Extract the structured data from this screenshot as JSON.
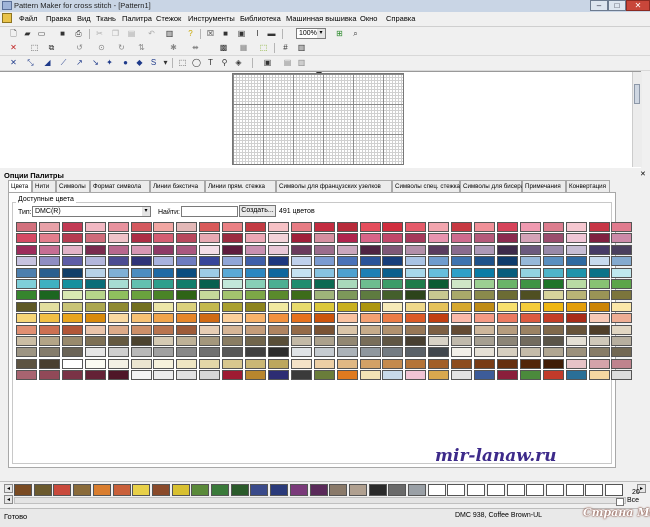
{
  "window": {
    "title": "Pattern Maker for cross stitch - [Pattern1]",
    "minimize_glyph": "–",
    "maximize_glyph": "□",
    "close_glyph": "✕"
  },
  "menu": [
    "Файл",
    "Правка",
    "Вид",
    "Ткань",
    "Палитра",
    "Стежок",
    "Инструменты",
    "Библиотека",
    "Машинная вышивка",
    "Окно",
    "Справка"
  ],
  "toolbar": {
    "zoom_value": "100%",
    "dropdown_glyph": "▾"
  },
  "palette_panel": {
    "title": "Опции Палитры",
    "close_glyph": "✕",
    "tabs": [
      "Цвета",
      "Нити",
      "Символы",
      "Формат символа",
      "Линии бэкстича",
      "Линии прям. стежка",
      "Символы для французских узелков",
      "Символы спец. стежка",
      "Символы для бисера",
      "Примечания",
      "Конвертация"
    ],
    "active_tab": 0,
    "group_title": "Доступные цвета",
    "type_label": "Тип:",
    "type_value": "DMC(R)",
    "find_label": "Найти:",
    "find_value": "",
    "create_button": "Создать...",
    "color_count": "491 цветов"
  },
  "swatch_rows": [
    [
      "#d2707d",
      "#e8a1a8",
      "#c23a54",
      "#f2b8c3",
      "#e8929e",
      "#d4595f",
      "#f1a6a2",
      "#e3b8b7",
      "#d85a5a",
      "#ea8084",
      "#c33b43",
      "#f6c1c5",
      "#e77c84",
      "#c32c40",
      "#b72a3a",
      "#e44d5c",
      "#d02e3e",
      "#e55b6a",
      "#f2a5ae",
      "#c73942",
      "#f09098",
      "#d6435a",
      "#ef9ab0",
      "#dc7d8e",
      "#f5c7d0",
      "#c73646",
      "#e07b8e"
    ],
    [
      "#d54963",
      "#e37e8d",
      "#b63b50",
      "#cf6b7a",
      "#f0c3c9",
      "#ad2d45",
      "#d45d72",
      "#b8485d",
      "#e8a9b3",
      "#9c2b40",
      "#eca7b5",
      "#f4d3d9",
      "#a01f3a",
      "#d58fa0",
      "#b0234d",
      "#d86488",
      "#c14769",
      "#a5385a",
      "#e894b0",
      "#ce6b8e",
      "#b55a7a",
      "#8b2b4f",
      "#d5a3b8",
      "#9a4d6d",
      "#f0c6d6",
      "#7f2040",
      "#cc8aa8"
    ],
    [
      "#9d2b5b",
      "#c66e93",
      "#e3b3c7",
      "#7a2a4e",
      "#b7678d",
      "#d796b3",
      "#8e3a66",
      "#a9577f",
      "#f4dde7",
      "#5f1c3d",
      "#c88fb0",
      "#e9c7d7",
      "#6b3a5c",
      "#9b6d8c",
      "#caa6bd",
      "#4f2342",
      "#7f5877",
      "#b38fa9",
      "#5a3b5f",
      "#8a6b8e",
      "#ad98b6",
      "#3d2a4a",
      "#6c5a7e",
      "#9889a8",
      "#c6bdd3",
      "#473b66",
      "#4a3f5e"
    ],
    [
      "#c7c3e0",
      "#8f8dc2",
      "#5f5da6",
      "#b3b6dc",
      "#4b4b91",
      "#2f3478",
      "#a8b2de",
      "#6e7cc0",
      "#38459a",
      "#90a6d8",
      "#3f5fa9",
      "#1e377f",
      "#bfd0ec",
      "#7b9bd1",
      "#4a72b8",
      "#2a5399",
      "#173e7b",
      "#a9c3e4",
      "#6f9bcd",
      "#3e73af",
      "#1f528a",
      "#0f3b6b",
      "#96b8d9",
      "#5a8fc0",
      "#2f6aa0",
      "#c8dbee",
      "#84aacf"
    ],
    [
      "#4d7fae",
      "#2b5f8f",
      "#123f69",
      "#b7d2e8",
      "#7fb0d6",
      "#4c8dc0",
      "#1f6aa5",
      "#0a4d80",
      "#9ccbe6",
      "#5aa9d6",
      "#2b87c0",
      "#0e679e",
      "#c4e2f1",
      "#87c3e1",
      "#4ea1cf",
      "#1d80b5",
      "#0a5f8d",
      "#a7d8ea",
      "#66bedc",
      "#2ea0c8",
      "#0a7ca6",
      "#075d7c",
      "#92d3e0",
      "#4fb4c9",
      "#1f94ab",
      "#0b7388",
      "#bfe8ee"
    ],
    [
      "#7fcfd9",
      "#3fb1c0",
      "#16909e",
      "#0a6d78",
      "#a7dcd2",
      "#63c0b0",
      "#2e9f8c",
      "#127d6b",
      "#07604f",
      "#c2e8da",
      "#88cfb7",
      "#4caf92",
      "#1f8d6f",
      "#0d6a52",
      "#a9d9bb",
      "#6dbd8f",
      "#3c9c68",
      "#1d7c4a",
      "#0b5c33",
      "#cfe6c6",
      "#9ccf92",
      "#6ab468",
      "#3f9444",
      "#1f7429",
      "#b9dba4",
      "#88c273",
      "#5ca54a"
    ],
    [
      "#36852e",
      "#1c6620",
      "#d8e8b2",
      "#b6d58a",
      "#8fbf5e",
      "#6aa23e",
      "#4a8427",
      "#2f6416",
      "#c6d99a",
      "#a3c36e",
      "#7da747",
      "#5a8a2c",
      "#3d6c1a",
      "#9fb47a",
      "#7d985a",
      "#5e7b40",
      "#445f2c",
      "#2d441b",
      "#c8c890",
      "#a9a96a",
      "#8a8a4c",
      "#6c6c34",
      "#4f4f22",
      "#d7d39c",
      "#b9b476",
      "#9a9456",
      "#7c753c"
    ],
    [
      "#5f5926",
      "#e3df9f",
      "#c9c476",
      "#aca74f",
      "#8f8a32",
      "#737020",
      "#ece6a8",
      "#dbd17c",
      "#c4b94d",
      "#aaa030",
      "#8d841e",
      "#f1e9a0",
      "#e8db6c",
      "#dcc83b",
      "#c9b01f",
      "#ad960f",
      "#f6eab8",
      "#efd88a",
      "#e5c25a",
      "#d6a82e",
      "#bf8c16",
      "#f8e06e",
      "#f4cc3a",
      "#efb612",
      "#e39e0a",
      "#cc8506",
      "#fbe7a9"
    ],
    [
      "#f7d577",
      "#f2bf44",
      "#e9a51d",
      "#d98a0b",
      "#fad9a0",
      "#f6c174",
      "#f0a44b",
      "#e5862a",
      "#d06a14",
      "#fbcf9a",
      "#f7b26a",
      "#f1913e",
      "#e6711d",
      "#cc540c",
      "#f9c2a0",
      "#f4a072",
      "#ec7c46",
      "#dc5a26",
      "#c13f12",
      "#fab8a8",
      "#f49a84",
      "#eb7a60",
      "#dc5a3f",
      "#c43d26",
      "#a82c18",
      "#f7c9b6",
      "#eeae94"
    ],
    [
      "#e08f72",
      "#cc7052",
      "#b15638",
      "#e9c3a9",
      "#dcaa88",
      "#cc8f69",
      "#b8744f",
      "#9d5b39",
      "#e6cdb4",
      "#d6b596",
      "#c49c79",
      "#ae8360",
      "#946a48",
      "#7a5334",
      "#d9c4a8",
      "#c6ab8a",
      "#b0916f",
      "#977757",
      "#7d5f43",
      "#644a32",
      "#cdb69b",
      "#b59c7e",
      "#9b8263",
      "#80694c",
      "#675339",
      "#4f3e29",
      "#e1d6c2"
    ],
    [
      "#cbbda4",
      "#b3a487",
      "#998a6d",
      "#7e7055",
      "#655940",
      "#4c432f",
      "#d5cab3",
      "#beb197",
      "#a4977c",
      "#8a7d63",
      "#71654c",
      "#594e38",
      "#c3b9a6",
      "#aca18c",
      "#928772",
      "#796e5a",
      "#605644",
      "#483f31",
      "#d8d2c6",
      "#c0b9ab",
      "#a69f91",
      "#8c8577",
      "#736c5f",
      "#5b5549",
      "#e4dfd4",
      "#cfc8ba",
      "#b7af9f"
    ],
    [
      "#9d9584",
      "#847c6c",
      "#6b6457",
      "#e6e6e6",
      "#cfcfcf",
      "#b8b8b8",
      "#a0a0a0",
      "#888888",
      "#707070",
      "#585858",
      "#404040",
      "#2c2c2c",
      "#dfe3e6",
      "#c5cbd0",
      "#abb2b8",
      "#8f979e",
      "#747c83",
      "#5a6168",
      "#41474d",
      "#f2efe8",
      "#e5e0d5",
      "#d6cfc0",
      "#c4bba9",
      "#b0a692",
      "#9c917c",
      "#877c67",
      "#726853"
    ],
    [
      "#5d5341",
      "#493f30",
      "#ffffff",
      "#fafaf2",
      "#f3f0e4",
      "#ebe5d0",
      "#f7f2dc",
      "#efe6c3",
      "#e4d7a8",
      "#d8c78e",
      "#cab775",
      "#bca75e",
      "#f5e3c7",
      "#eccfa5",
      "#e0b884",
      "#d3a166",
      "#c48a4d",
      "#b47438",
      "#a25f28",
      "#8d4c1d",
      "#793c15",
      "#66300f",
      "#522509",
      "#401c06",
      "#e7c3c7",
      "#d4a3aa",
      "#bf838d"
    ],
    [
      "#a86470",
      "#914958",
      "#7a3346",
      "#642236",
      "#4f1628",
      "#f4f4f4",
      "#ebebeb",
      "#e1e1e1",
      "#d7d7d7",
      "#9e1b32",
      "#b8862e",
      "#2d2d73",
      "#3a3a3a",
      "#6a7d3a",
      "#e07a1f",
      "#f2e3b5",
      "#c8d9e8",
      "#f0c4d4",
      "#d9a84e",
      "#e3e3e3",
      "#3d5c99",
      "#8a1f3b",
      "#4b8a3c",
      "#c13a2a",
      "#2a6f97",
      "#f5d7a1",
      "#dddddd"
    ]
  ],
  "bottom_palette": {
    "colors": [
      "#7a4b23",
      "#6b5a2e",
      "#c94a3c",
      "#8a6b3a",
      "#d97d2e",
      "#c9603a",
      "#e8d048",
      "#8a4a2a",
      "#d8c030",
      "#5a8a3a",
      "#3a7a3a",
      "#2a5a2a",
      "#3a4a8a",
      "#2a3a7a",
      "#7a3a7a",
      "#5a2a5a",
      "#8a7a6a",
      "#b0a090",
      "#2a2a2a",
      "#6a6a6a",
      "#9aa0a6"
    ],
    "empty_slots": 10,
    "count": "20",
    "all_label": "Все"
  },
  "status": {
    "ready": "Готово",
    "thread": "DMC  938, Coffee Brown-UL"
  },
  "watermark": "mir-lanaw.ru",
  "site_logo": "Страна Мам"
}
